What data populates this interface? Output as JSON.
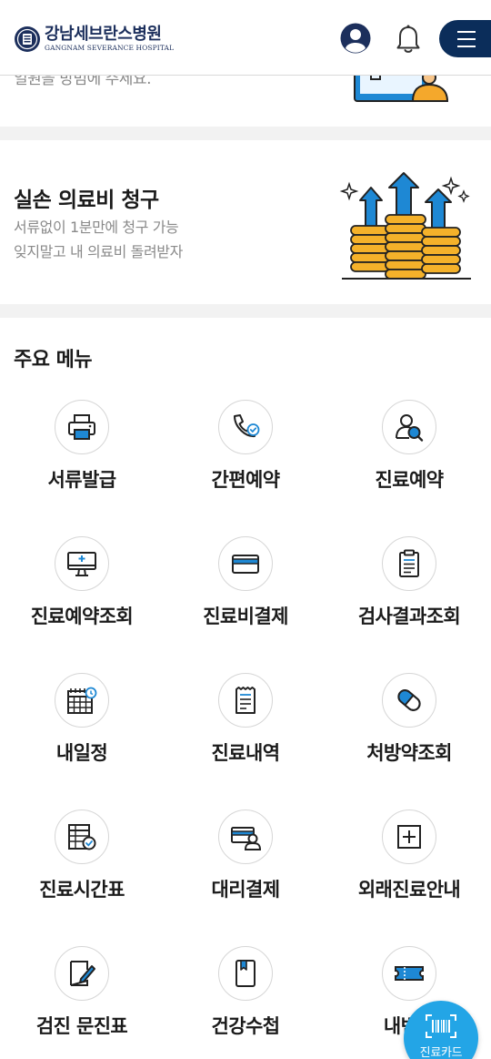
{
  "header": {
    "logo_ko": "강남세브란스병원",
    "logo_en": "GANGNAM SEVERANCE HOSPITAL",
    "user_icon": "user-icon",
    "bell_icon": "bell-icon",
    "menu_icon": "hamburger-menu-icon"
  },
  "banner_top": {
    "text": "일원을 방범에 주세요."
  },
  "claim": {
    "title": "실손 의료비 청구",
    "sub1": "서류없이 1분만에 청구 가능",
    "sub2": "잊지말고 내 의료비 돌려받자"
  },
  "menu": {
    "title": "주요 메뉴",
    "items": [
      {
        "label": "서류발급",
        "icon": "printer-icon"
      },
      {
        "label": "간편예약",
        "icon": "phone-check-icon"
      },
      {
        "label": "진료예약",
        "icon": "doctor-search-icon"
      },
      {
        "label": "진료예약조회",
        "icon": "monitor-icon"
      },
      {
        "label": "진료비결제",
        "icon": "credit-card-icon"
      },
      {
        "label": "검사결과조회",
        "icon": "clipboard-icon"
      },
      {
        "label": "내일정",
        "icon": "calendar-icon"
      },
      {
        "label": "진료내역",
        "icon": "receipt-icon"
      },
      {
        "label": "처방약조회",
        "icon": "pill-icon"
      },
      {
        "label": "진료시간표",
        "icon": "timetable-icon"
      },
      {
        "label": "대리결제",
        "icon": "proxy-payment-icon"
      },
      {
        "label": "외래진료안내",
        "icon": "plus-square-icon"
      },
      {
        "label": "검진 문진표",
        "icon": "questionnaire-icon"
      },
      {
        "label": "건강수첩",
        "icon": "health-notebook-icon"
      },
      {
        "label": "내번호",
        "icon": "ticket-icon"
      }
    ]
  },
  "fab": {
    "label": "진료카드",
    "icon": "barcode-icon"
  },
  "colors": {
    "navy": "#1c2f5c",
    "menu_button": "#0b2d5a",
    "accent_blue": "#1e88d4",
    "fab_blue": "#23a5e6"
  }
}
